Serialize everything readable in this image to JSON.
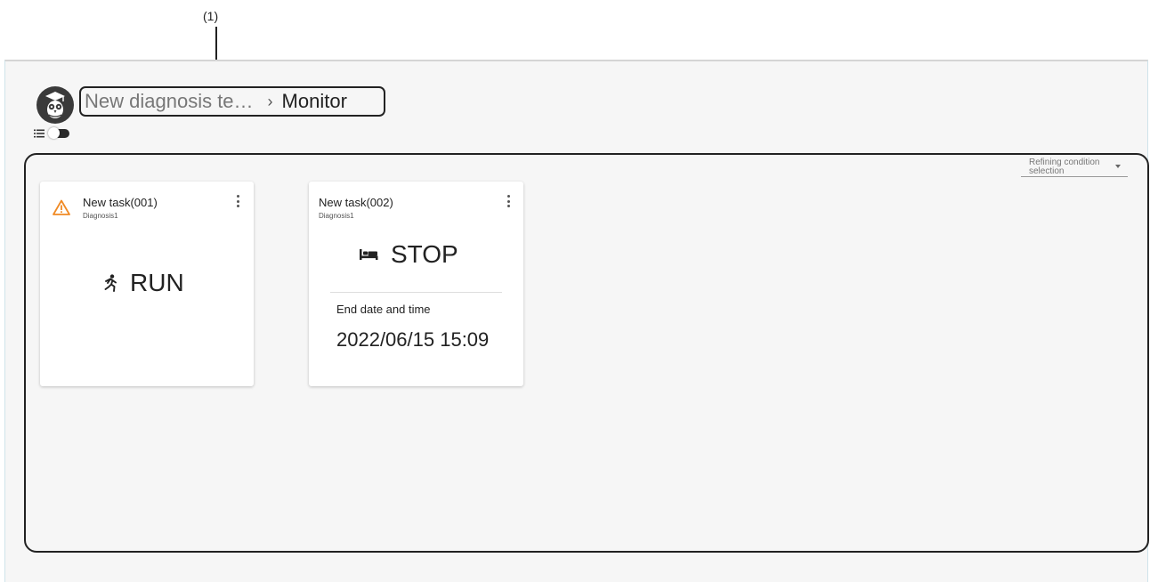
{
  "callout": {
    "label": "(1)"
  },
  "breadcrumb": {
    "first": "New diagnosis te…",
    "separator": "›",
    "current": "Monitor"
  },
  "icons": {
    "logo": "owl-graduate-icon",
    "list": "list-icon",
    "warning": "warning-icon",
    "run": "running-person-icon",
    "stop": "bed-icon",
    "menu": "more-vert-icon"
  },
  "filter": {
    "label": "Refining condition selection"
  },
  "cards": [
    {
      "title": "New task(001)",
      "subtitle": "Diagnosis1",
      "status": "RUN",
      "warning": true
    },
    {
      "title": "New task(002)",
      "subtitle": "Diagnosis1",
      "status": "STOP",
      "end_label": "End date and time",
      "end_value": "2022/06/15 15:09"
    }
  ],
  "colors": {
    "warning": "#f08a24",
    "logo_bg": "#3a3a3a"
  }
}
